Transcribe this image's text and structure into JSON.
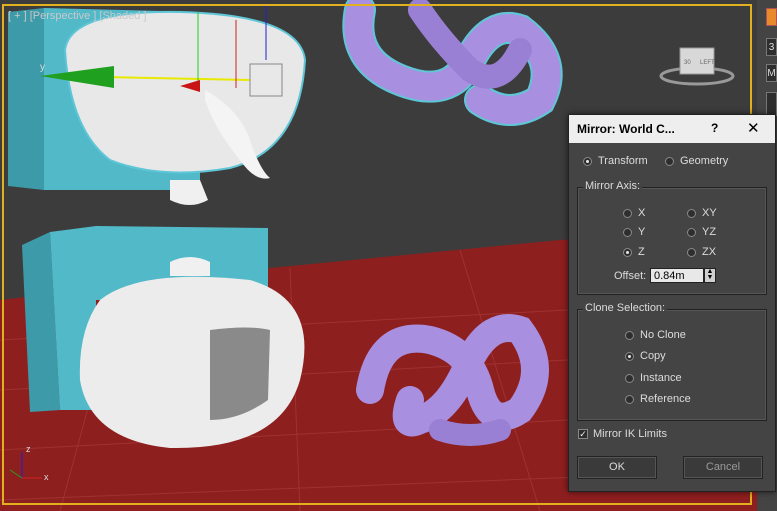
{
  "viewport": {
    "label": "[ + ] [Perspective ] [Shaded ]",
    "axis_y_label": "y",
    "corner_axes": {
      "z": "z",
      "x": "x"
    }
  },
  "viewcube": {
    "front": "30",
    "left": "LEFT"
  },
  "right_strip": {
    "b1": "3",
    "b2": "M"
  },
  "dialog": {
    "title": "Mirror: World C...",
    "help_icon": "?",
    "close_icon": "✕",
    "modes": [
      {
        "label": "Transform",
        "selected": true
      },
      {
        "label": "Geometry",
        "selected": false
      }
    ],
    "mirror_axis": {
      "title": "Mirror Axis:",
      "options": [
        {
          "label": "X",
          "selected": false
        },
        {
          "label": "XY",
          "selected": false
        },
        {
          "label": "Y",
          "selected": false
        },
        {
          "label": "YZ",
          "selected": false
        },
        {
          "label": "Z",
          "selected": true
        },
        {
          "label": "ZX",
          "selected": false
        }
      ],
      "offset_label": "Offset:",
      "offset_value": "0.84m"
    },
    "clone_selection": {
      "title": "Clone Selection:",
      "options": [
        {
          "label": "No Clone",
          "selected": false
        },
        {
          "label": "Copy",
          "selected": true
        },
        {
          "label": "Instance",
          "selected": false
        },
        {
          "label": "Reference",
          "selected": false
        }
      ]
    },
    "mirror_ik": {
      "label": "Mirror IK Limits",
      "checked": true
    },
    "ok_label": "OK",
    "cancel_label": "Cancel"
  },
  "colors": {
    "selection_border": "#e0b01e",
    "floor": "#8e1f1f",
    "wall": "#52b9c9",
    "knot": "#a98fe0",
    "teapot": "#ececec"
  }
}
